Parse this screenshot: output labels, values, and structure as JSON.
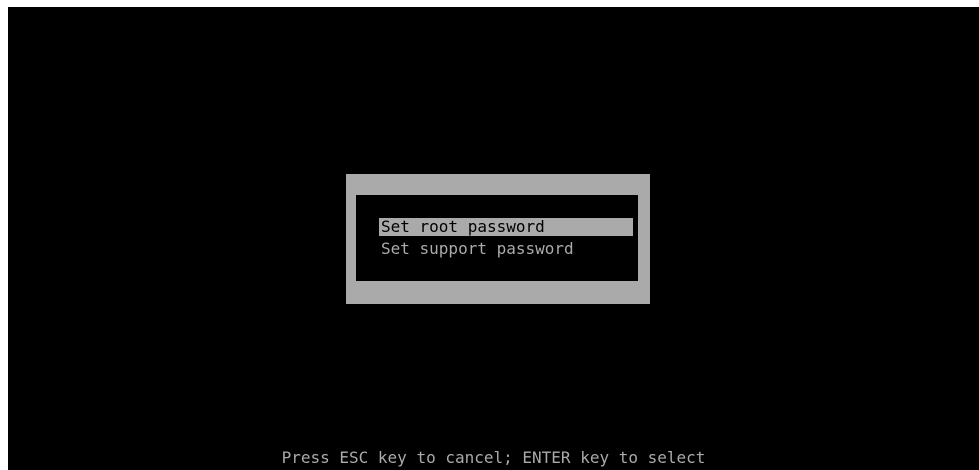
{
  "menu": {
    "items": [
      {
        "label": "Set root password",
        "selected": true
      },
      {
        "label": "Set support password",
        "selected": false
      }
    ]
  },
  "footer": {
    "hint": "Press ESC key to cancel; ENTER key to select"
  },
  "colors": {
    "screen_background": "#000000",
    "dialog_frame": "#aaaaaa",
    "text": "#aaaaaa",
    "selection_background": "#aaaaaa",
    "selection_text": "#000000"
  }
}
